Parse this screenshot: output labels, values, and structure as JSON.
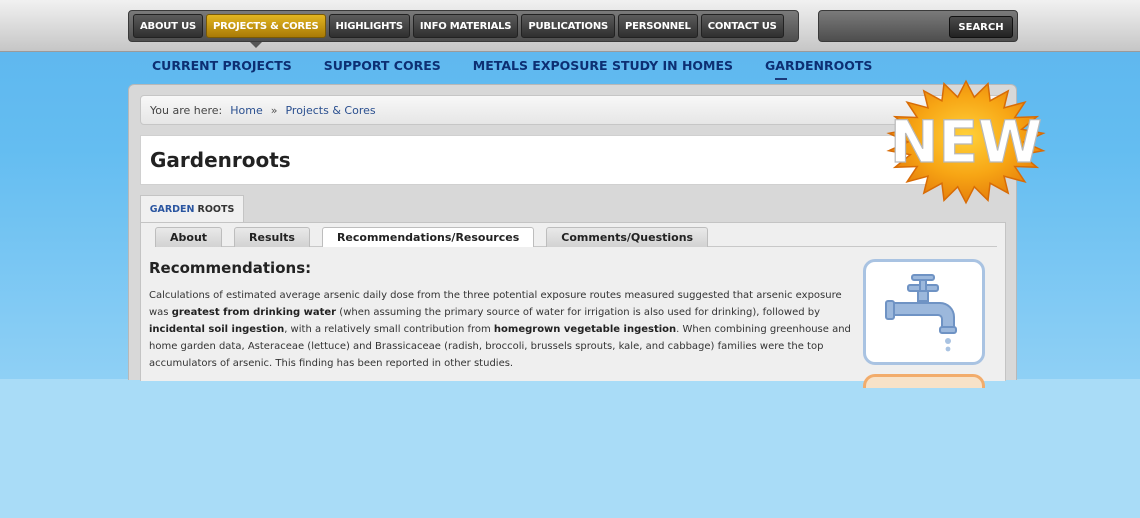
{
  "main_nav": {
    "items": [
      {
        "label": "ABOUT US",
        "active": false
      },
      {
        "label": "PROJECTS & CORES",
        "active": true
      },
      {
        "label": "HIGHLIGHTS",
        "active": false
      },
      {
        "label": "INFO MATERIALS",
        "active": false
      },
      {
        "label": "PUBLICATIONS",
        "active": false
      },
      {
        "label": "PERSONNEL",
        "active": false
      },
      {
        "label": "CONTACT US",
        "active": false
      }
    ]
  },
  "search": {
    "button_label": "SEARCH",
    "value": ""
  },
  "sub_nav": {
    "items": [
      {
        "label": "CURRENT PROJECTS"
      },
      {
        "label": "SUPPORT CORES"
      },
      {
        "label": "METALS EXPOSURE STUDY IN HOMES"
      },
      {
        "label": "GARDENROOTS"
      }
    ]
  },
  "breadcrumb": {
    "prefix": "You are here:",
    "items": [
      "Home",
      "Projects & Cores"
    ],
    "separator": "»"
  },
  "page_title": "Gardenroots",
  "site_tab": {
    "part1": "GARDEN",
    "part2": "ROOTS"
  },
  "tabs": [
    {
      "label": "About",
      "active": false
    },
    {
      "label": "Results",
      "active": false
    },
    {
      "label": "Recommendations/Resources",
      "active": true
    },
    {
      "label": "Comments/Questions",
      "active": false
    }
  ],
  "content": {
    "heading": "Recommendations:",
    "paragraph": [
      {
        "text": "Calculations of estimated average arsenic daily dose from the three potential exposure routes measured suggested that arsenic exposure was ",
        "bold": false
      },
      {
        "text": "greatest from drinking water",
        "bold": true
      },
      {
        "text": " (when assuming the primary source of water for irrigation is also used for drinking), followed by ",
        "bold": false
      },
      {
        "text": "incidental soil ingestion",
        "bold": true
      },
      {
        "text": ", with a relatively small contribution from ",
        "bold": false
      },
      {
        "text": "homegrown vegetable ingestion",
        "bold": true
      },
      {
        "text": ". When combining greenhouse and home garden data, Asteraceae (lettuce) and Brassicaceae (radish, broccoli, brussels sprouts, kale, and cabbage) families were the top accumulators of arsenic. This finding has been reported in other studies.",
        "bold": false
      }
    ]
  },
  "badge": {
    "label": "NEW"
  },
  "icons": {
    "faucet": "faucet-icon"
  },
  "colors": {
    "accent_gold": "#d4a418",
    "nav_dark": "#3e3e3e",
    "link_blue": "#0d2f73",
    "badge_orange": "#f39a12",
    "page_blue": "#64bdf1"
  }
}
